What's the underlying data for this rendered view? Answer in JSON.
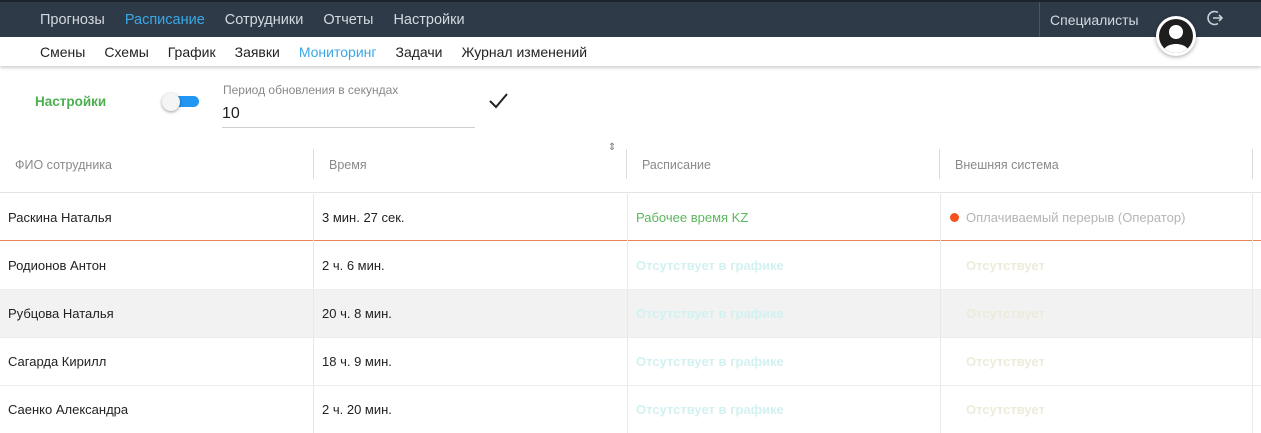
{
  "top_nav": {
    "items": [
      {
        "label": "Прогнозы",
        "active": false
      },
      {
        "label": "Расписание",
        "active": true
      },
      {
        "label": "Сотрудники",
        "active": false
      },
      {
        "label": "Отчеты",
        "active": false
      },
      {
        "label": "Настройки",
        "active": false
      }
    ],
    "right_label": "Специалисты",
    "avatar_icon": "user-avatar-icon",
    "logout_icon": "logout-icon"
  },
  "sub_nav": {
    "items": [
      {
        "label": "Смены",
        "active": false
      },
      {
        "label": "Схемы",
        "active": false
      },
      {
        "label": "График",
        "active": false
      },
      {
        "label": "Заявки",
        "active": false
      },
      {
        "label": "Мониторинг",
        "active": true
      },
      {
        "label": "Задачи",
        "active": false
      },
      {
        "label": "Журнал изменений",
        "active": false
      }
    ]
  },
  "settings": {
    "label": "Настройки",
    "toggle_on": true,
    "period_caption": "Период обновления в секундах",
    "period_value": "10"
  },
  "table": {
    "columns": [
      "ФИО сотрудника",
      "Время",
      "Расписание",
      "Внешняя система"
    ],
    "rows": [
      {
        "name": "Раскина Наталья",
        "time": "3 мин. 27 сек.",
        "schedule": "Рабочее время KZ",
        "external": "Оплачиваемый перерыв (Оператор)"
      },
      {
        "name": "Родионов Антон",
        "time": "2 ч. 6 мин.",
        "schedule": "Отсутствует в графике",
        "external": "Отсутствует"
      },
      {
        "name": "Рубцова Наталья",
        "time": "20 ч. 8 мин.",
        "schedule": "Отсутствует в графике",
        "external": "Отсутствует"
      },
      {
        "name": "Сагарда Кирилл",
        "time": "18 ч. 9 мин.",
        "schedule": "Отсутствует в графике",
        "external": "Отсутствует"
      },
      {
        "name": "Саенко Александра",
        "time": "2 ч. 20 мин.",
        "schedule": "Отсутствует в графике",
        "external": "Отсутствует"
      }
    ]
  },
  "colors": {
    "topbar": "#2e3a48",
    "accent": "#3aa8e6",
    "settings_green": "#4caf50",
    "status_dot": "#f4511e",
    "row_highlight": "#e8835a"
  }
}
